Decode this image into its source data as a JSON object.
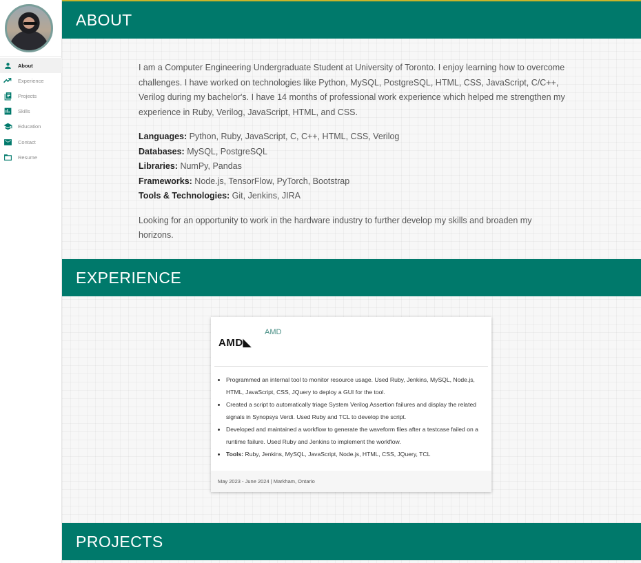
{
  "sidebar": {
    "items": [
      {
        "label": "About",
        "icon": "person-icon",
        "active": true
      },
      {
        "label": "Experience",
        "icon": "trending-up-icon",
        "active": false
      },
      {
        "label": "Projects",
        "icon": "library-books-icon",
        "active": false
      },
      {
        "label": "Skills",
        "icon": "bar-chart-icon",
        "active": false
      },
      {
        "label": "Education",
        "icon": "school-icon",
        "active": false
      },
      {
        "label": "Contact",
        "icon": "mail-icon",
        "active": false
      },
      {
        "label": "Resume",
        "icon": "folder-icon",
        "active": false
      }
    ]
  },
  "colors": {
    "accent": "#00796b",
    "topbar": "#c9b52a"
  },
  "sections": {
    "about_title": "ABOUT",
    "experience_title": "EXPERIENCE",
    "projects_title": "PROJECTS"
  },
  "about": {
    "intro": "I am a Computer Engineering Undergraduate Student at University of Toronto. I enjoy learning how to overcome challenges. I have worked on technologies like Python, MySQL, PostgreSQL, HTML, CSS, JavaScript, C/C++, Verilog during my bachelor's. I have 14 months of professional work experience which helped me strengthen my experience in Ruby, Verilog, JavaScript, HTML, and CSS.",
    "skills": [
      {
        "label": "Languages:",
        "value": "Python, Ruby, JavaScript, C, C++, HTML, CSS, Verilog"
      },
      {
        "label": "Databases:",
        "value": "MySQL, PostgreSQL"
      },
      {
        "label": "Libraries:",
        "value": "NumPy, Pandas"
      },
      {
        "label": "Frameworks:",
        "value": "Node.js, TensorFlow, PyTorch, Bootstrap"
      },
      {
        "label": "Tools & Technologies:",
        "value": "Git, Jenkins, JIRA"
      }
    ],
    "outro": "Looking for an opportunity to work in the hardware industry to further develop my skills and broaden my horizons."
  },
  "experience": {
    "logo_text": "AMD◣",
    "company": "AMD",
    "bullets": [
      "Programmed an internal tool to monitor resource usage. Used Ruby, Jenkins, MySQL, Node.js, HTML, JavaScript, CSS, JQuery to deploy a GUI for the tool.",
      "Created a script to automatically triage System Verilog Assertion failures and display the related signals in Synopsys Verdi. Used Ruby and TCL to develop the script.",
      "Developed and maintained a workflow to generate the waveform files after a testcase failed on a runtime failure. Used Ruby and Jenkins to implement the workflow."
    ],
    "tools_label": "Tools:",
    "tools_value": "Ruby, Jenkins, MySQL, JavaScript, Node.js, HTML, CSS, JQuery, TCL",
    "footer": "May 2023 - June 2024 | Markham, Ontario"
  }
}
